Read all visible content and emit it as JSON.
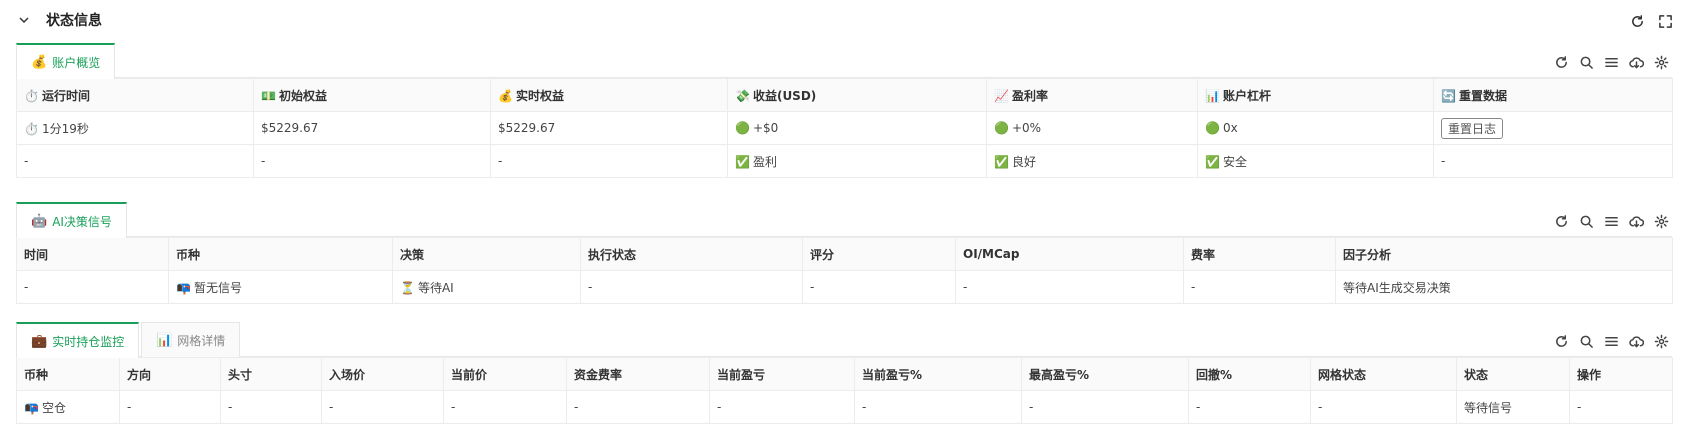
{
  "header": {
    "title": "状态信息"
  },
  "account": {
    "tab": {
      "emoji": "💰",
      "label": "账户概览"
    },
    "columns": [
      {
        "emoji": "⏱️",
        "label": "运行时间"
      },
      {
        "emoji": "💵",
        "label": "初始权益"
      },
      {
        "emoji": "💰",
        "label": "实时权益"
      },
      {
        "emoji": "💸",
        "label": "收益(USD)"
      },
      {
        "emoji": "📈",
        "label": "盈利率"
      },
      {
        "emoji": "📊",
        "label": "账户杠杆"
      },
      {
        "emoji": "🔄",
        "label": "重置数据"
      }
    ],
    "row1": [
      {
        "emoji": "⏱️",
        "text": "1分19秒"
      },
      {
        "emoji": "",
        "text": "$5229.67"
      },
      {
        "emoji": "",
        "text": "$5229.67"
      },
      {
        "emoji": "🟢",
        "text": "+$0"
      },
      {
        "emoji": "🟢",
        "text": "+0%"
      },
      {
        "emoji": "🟢",
        "text": "0x"
      }
    ],
    "reset_button": "重置日志",
    "row2": [
      {
        "emoji": "",
        "text": "-"
      },
      {
        "emoji": "",
        "text": "-"
      },
      {
        "emoji": "",
        "text": "-"
      },
      {
        "emoji": "✅",
        "text": "盈利"
      },
      {
        "emoji": "✅",
        "text": "良好"
      },
      {
        "emoji": "✅",
        "text": "安全"
      },
      {
        "emoji": "",
        "text": "-"
      }
    ]
  },
  "ai": {
    "tab": {
      "emoji": "🤖",
      "label": "AI决策信号"
    },
    "columns": [
      "时间",
      "币种",
      "决策",
      "执行状态",
      "评分",
      "OI/MCap",
      "费率",
      "因子分析"
    ],
    "row": [
      {
        "emoji": "",
        "text": "-"
      },
      {
        "emoji": "📭",
        "text": "暂无信号"
      },
      {
        "emoji": "⏳",
        "text": "等待AI"
      },
      {
        "emoji": "",
        "text": "-"
      },
      {
        "emoji": "",
        "text": "-"
      },
      {
        "emoji": "",
        "text": "-"
      },
      {
        "emoji": "",
        "text": "-"
      },
      {
        "emoji": "",
        "text": "等待AI生成交易决策"
      }
    ]
  },
  "positions": {
    "tab_active": {
      "emoji": "💼",
      "label": "实时持仓监控"
    },
    "tab_inactive": {
      "emoji": "📊",
      "label": "网格详情"
    },
    "columns": [
      "币种",
      "方向",
      "头寸",
      "入场价",
      "当前价",
      "资金费率",
      "当前盈亏",
      "当前盈亏%",
      "最高盈亏%",
      "回撤%",
      "网格状态",
      "状态",
      "操作"
    ],
    "row": [
      {
        "emoji": "📭",
        "text": "空仓"
      },
      {
        "emoji": "",
        "text": "-"
      },
      {
        "emoji": "",
        "text": "-"
      },
      {
        "emoji": "",
        "text": "-"
      },
      {
        "emoji": "",
        "text": "-"
      },
      {
        "emoji": "",
        "text": "-"
      },
      {
        "emoji": "",
        "text": "-"
      },
      {
        "emoji": "",
        "text": "-"
      },
      {
        "emoji": "",
        "text": "-"
      },
      {
        "emoji": "",
        "text": "-"
      },
      {
        "emoji": "",
        "text": "-"
      },
      {
        "emoji": "",
        "text": "等待信号"
      },
      {
        "emoji": "",
        "text": "-"
      }
    ]
  }
}
